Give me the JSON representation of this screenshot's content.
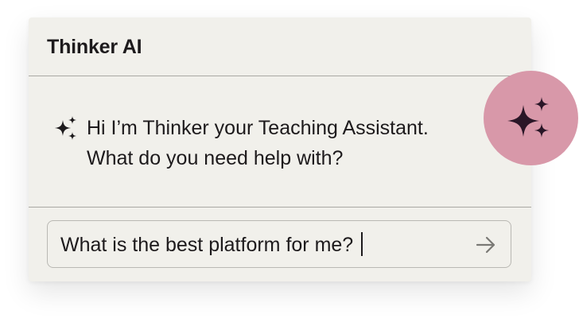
{
  "chat": {
    "title": "Thinker AI",
    "message_line1": "Hi I’m Thinker your Teaching Assistant.",
    "message_line2": "What do you need help with?",
    "input_value": "What is the best platform for me?",
    "send_icon": "arrow-right-icon",
    "assistant_icon": "sparkles-icon"
  },
  "colors": {
    "card_background": "#f1f0eb",
    "badge_background": "#d898a9",
    "icon_color": "#2a1627",
    "text_color": "#1d1a1c"
  }
}
